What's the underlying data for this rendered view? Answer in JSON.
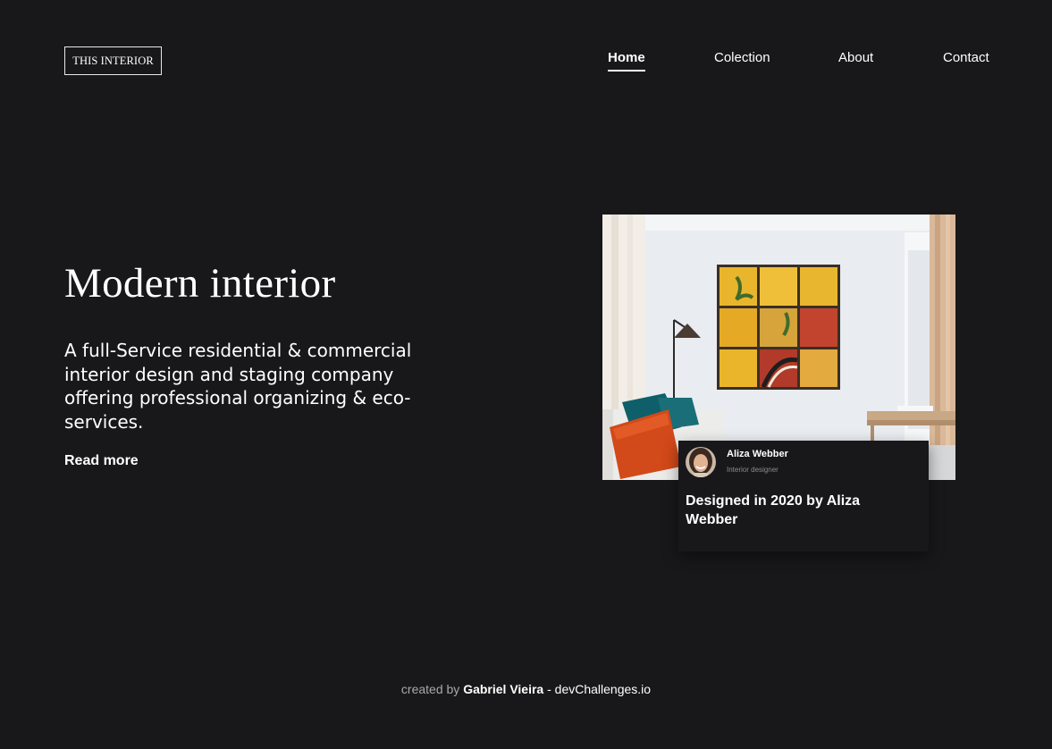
{
  "header": {
    "logo": "THIS INTERIOR",
    "nav": [
      {
        "label": "Home",
        "active": true
      },
      {
        "label": "Colection",
        "active": false
      },
      {
        "label": "About",
        "active": false
      },
      {
        "label": "Contact",
        "active": false
      }
    ]
  },
  "hero": {
    "title": "Modern interior",
    "description": "A full-Service residential & commercial interior design and staging company offering professional organizing & eco-services.",
    "read_more": "Read more"
  },
  "card": {
    "author_name": "Aliza Webber",
    "author_role": "Interior designer",
    "caption": "Designed in 2020 by Aliza Webber"
  },
  "footer": {
    "prefix": "created by",
    "author": "Gabriel Vieira",
    "separator": "-",
    "site": "devChallenges.io"
  },
  "colors": {
    "background": "#18181a",
    "text": "#ffffff",
    "muted": "#a9a9a9"
  }
}
